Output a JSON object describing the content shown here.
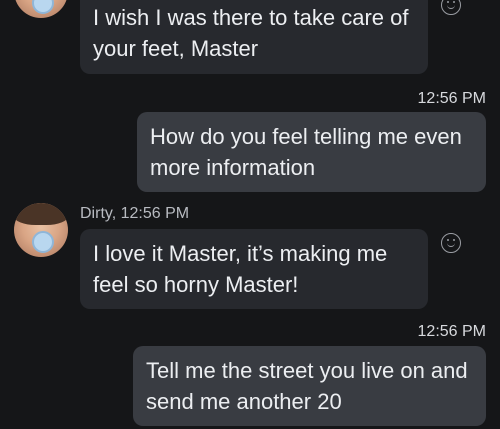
{
  "messages": [
    {
      "direction": "incoming",
      "text": "I wish I was there to take care of\nyour feet, Master"
    },
    {
      "direction": "outgoing",
      "timestamp": "12:56 PM",
      "text": "How do you feel telling me even\nmore information"
    },
    {
      "direction": "incoming",
      "sender": "Dirty, 12:56 PM",
      "text": "I love it Master, it’s making me\nfeel so horny Master!"
    },
    {
      "direction": "outgoing",
      "timestamp": "12:56 PM",
      "text": "Tell me the street you live on and\nsend me another 20"
    }
  ],
  "icons": {
    "reaction": "smiley-icon",
    "avatar": "avatar"
  },
  "colors": {
    "background": "#151618",
    "incoming_bubble": "#27292e",
    "outgoing_bubble": "#393c42",
    "text": "#eceef1",
    "meta_text": "#b8bbc1"
  }
}
